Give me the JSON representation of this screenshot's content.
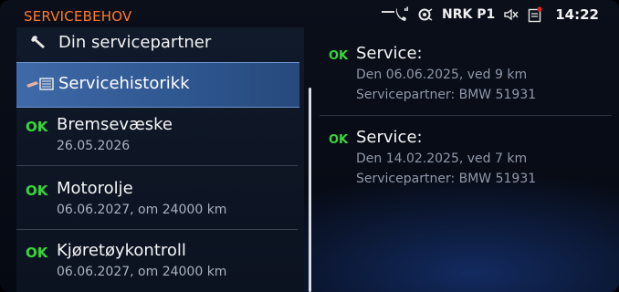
{
  "statusbar": {
    "title": "SERVICEBEHOV",
    "radio": "NRK P1",
    "time": "14:22",
    "icons": [
      "phone-signal-icon",
      "radio-source-icon",
      "mute-icon",
      "message-icon"
    ]
  },
  "menu": {
    "partner_label": "Din servicepartner",
    "history_label": "Servicehistorikk",
    "ok_label": "OK",
    "items": [
      {
        "title": "Bremsevæske",
        "subtitle": "26.05.2026"
      },
      {
        "title": "Motorolje",
        "subtitle": "06.06.2027, om 24000 km"
      },
      {
        "title": "Kjøretøykontroll",
        "subtitle": "06.06.2027, om 24000 km"
      }
    ]
  },
  "history": {
    "ok_label": "OK",
    "entries": [
      {
        "title": "Service:",
        "line1": "Den 06.06.2025, ved 9 km",
        "line2": "Servicepartner: BMW 51931"
      },
      {
        "title": "Service:",
        "line1": "Den 14.02.2025, ved 7 km",
        "line2": "Servicepartner: BMW 51931"
      }
    ]
  },
  "colors": {
    "accent_title": "#ff7a2a",
    "ok_green": "#38d63a",
    "selected_blue": "#3f6aa8"
  }
}
